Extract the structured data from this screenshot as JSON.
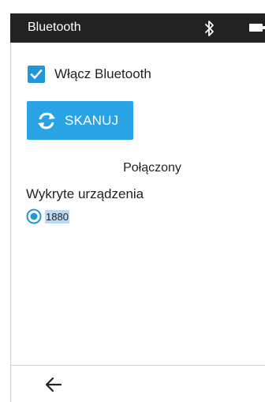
{
  "topbar": {
    "title": "Bluetooth",
    "bluetooth_icon": "bluetooth-icon",
    "battery_icon": "battery-icon"
  },
  "settings": {
    "enable_label": "Włącz Bluetooth",
    "enable_checked": true,
    "scan_button_label": "SKANUJ",
    "scan_icon": "refresh-icon",
    "status_text": "Połączony",
    "detected_heading": "Wykryte urządzenia",
    "devices": [
      {
        "label": "1880",
        "selected": true
      }
    ]
  },
  "bottom_nav": {
    "back_icon": "arrow-left-icon"
  },
  "colors": {
    "topbar_bg": "#222222",
    "accent": "#2196d9",
    "button_bg": "#29a3e6",
    "selection_highlight": "#b9d9f5"
  }
}
